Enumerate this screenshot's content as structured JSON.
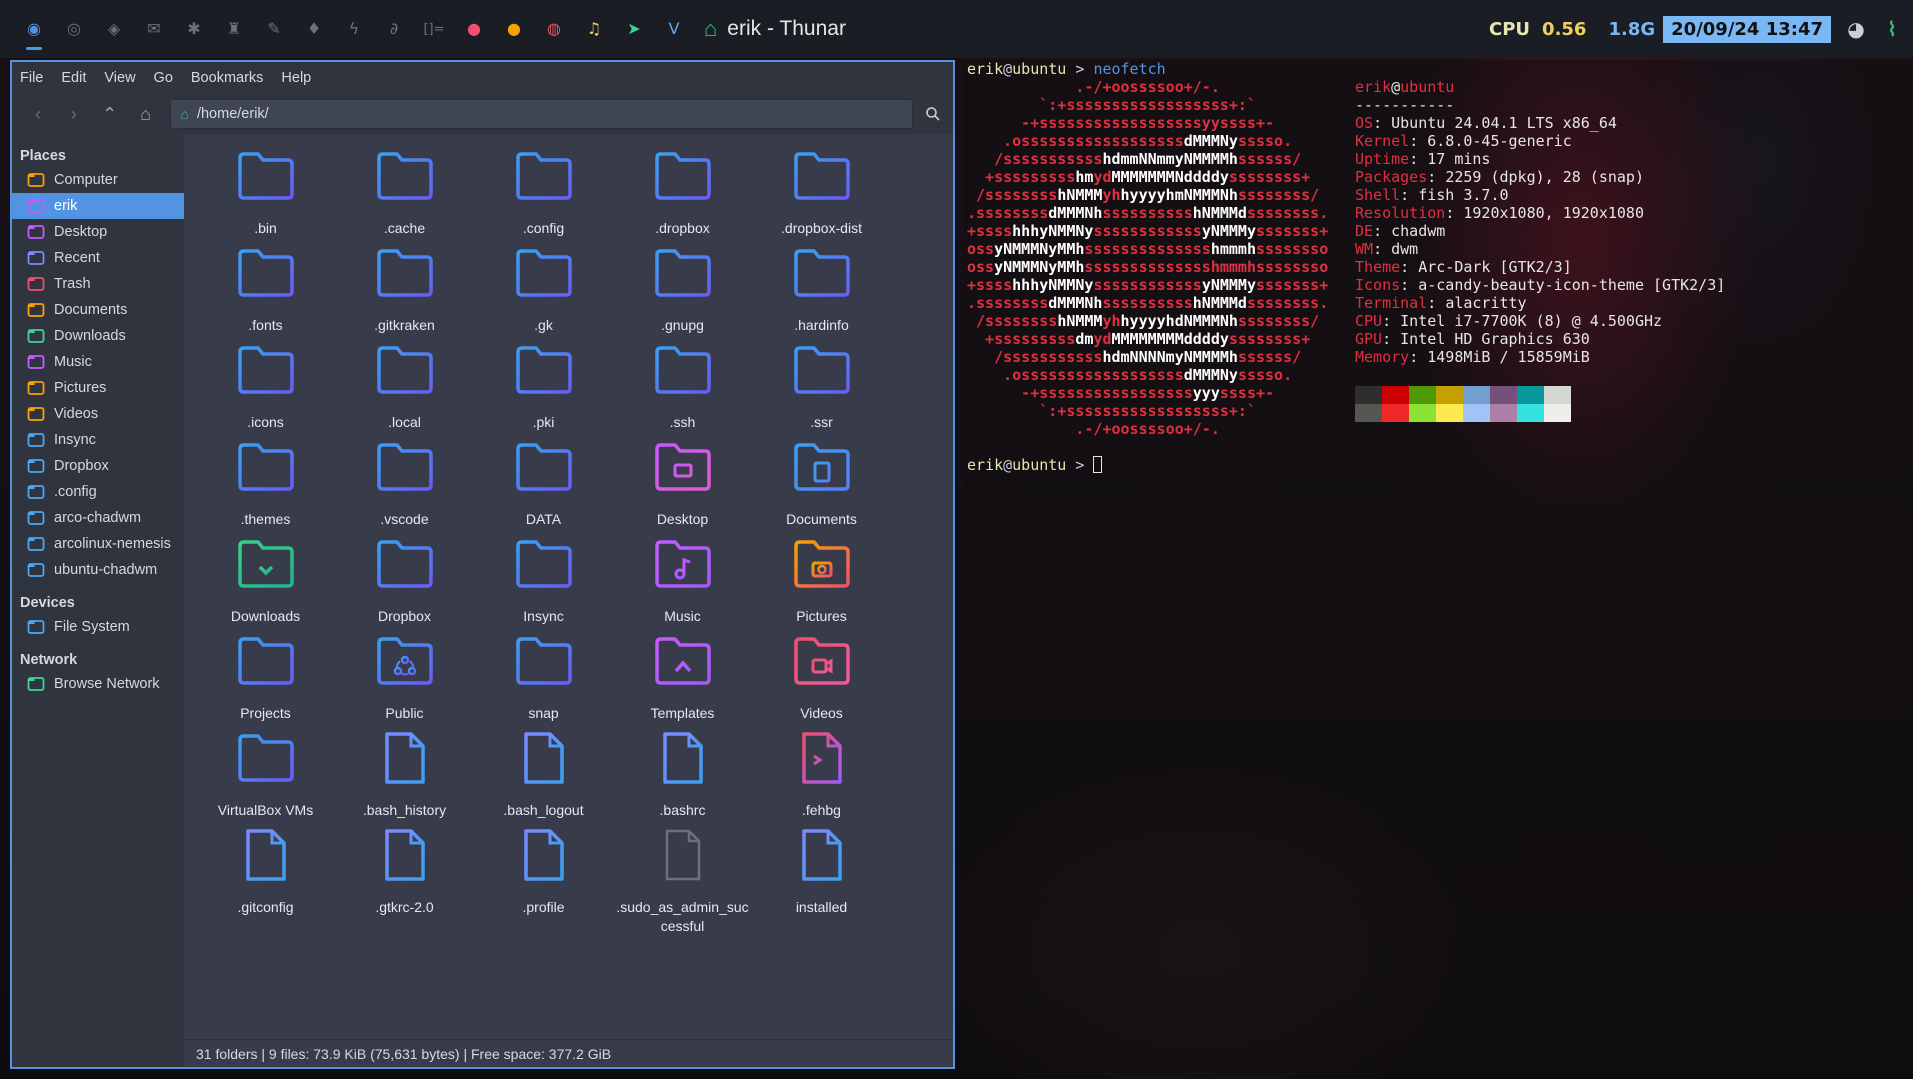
{
  "topbar": {
    "tags": [
      {
        "icon": "arch-icon",
        "glyph": "◉",
        "color": "#5294e2",
        "active": true
      },
      {
        "icon": "chrome-icon",
        "glyph": "◎",
        "color": "#6a7080"
      },
      {
        "icon": "pocket-icon",
        "glyph": "◈",
        "color": "#6a7080"
      },
      {
        "icon": "mail-icon",
        "glyph": "✉",
        "color": "#6a7080"
      },
      {
        "icon": "slack-icon",
        "glyph": "✱",
        "color": "#6a7080"
      },
      {
        "icon": "trophy-icon",
        "glyph": "♜",
        "color": "#6a7080"
      },
      {
        "icon": "wrench-icon",
        "glyph": "✎",
        "color": "#6a7080"
      },
      {
        "icon": "drop-icon",
        "glyph": "♦",
        "color": "#6a7080"
      },
      {
        "icon": "bolt-icon",
        "glyph": "ϟ",
        "color": "#6a7080"
      },
      {
        "icon": "paperclip-icon",
        "glyph": "∂",
        "color": "#6a7080"
      },
      {
        "icon": "layout-icon",
        "glyph": "[]=",
        "color": "#6a7080"
      },
      {
        "icon": "gitkraken-icon",
        "glyph": "●",
        "color": "#f0506e"
      },
      {
        "icon": "firefox-icon",
        "glyph": "●",
        "color": "#f7a200"
      },
      {
        "icon": "dribbble-icon",
        "glyph": "◍",
        "color": "#e8546a"
      },
      {
        "icon": "music-icon",
        "glyph": "♫",
        "color": "#f0d060"
      },
      {
        "icon": "telegram-icon",
        "glyph": "➤",
        "color": "#3fd494"
      },
      {
        "icon": "vivaldi-icon",
        "glyph": "V",
        "color": "#5aa8f0"
      }
    ],
    "window_title": "erik - Thunar",
    "cpu_label": "CPU",
    "cpu_value": "0.56",
    "mem_value": "1.8G",
    "datetime": "20/09/24 13:47"
  },
  "thunar": {
    "menu": [
      "File",
      "Edit",
      "View",
      "Go",
      "Bookmarks",
      "Help"
    ],
    "path": "/home/erik/",
    "sidebar": {
      "places_label": "Places",
      "places": [
        {
          "label": "Computer",
          "icon": "computer-icon",
          "color": "#f7a200"
        },
        {
          "label": "erik",
          "icon": "home-icon",
          "color": "#c45bff",
          "selected": true
        },
        {
          "label": "Desktop",
          "icon": "desktop-icon",
          "color": "#c45bff"
        },
        {
          "label": "Recent",
          "icon": "recent-icon",
          "color": "#7a8aff"
        },
        {
          "label": "Trash",
          "icon": "trash-icon",
          "color": "#f0506e"
        },
        {
          "label": "Documents",
          "icon": "documents-icon",
          "color": "#f7a200"
        },
        {
          "label": "Downloads",
          "icon": "downloads-icon",
          "color": "#3fd494"
        },
        {
          "label": "Music",
          "icon": "music-folder-icon",
          "color": "#c45bff"
        },
        {
          "label": "Pictures",
          "icon": "pictures-icon",
          "color": "#f7a200"
        },
        {
          "label": "Videos",
          "icon": "videos-icon",
          "color": "#f7a200"
        },
        {
          "label": "Insync",
          "icon": "folder-icon",
          "color": "#4aa8f5"
        },
        {
          "label": "Dropbox",
          "icon": "folder-icon",
          "color": "#4aa8f5"
        },
        {
          "label": ".config",
          "icon": "folder-icon",
          "color": "#4aa8f5"
        },
        {
          "label": "arco-chadwm",
          "icon": "folder-icon",
          "color": "#4aa8f5"
        },
        {
          "label": "arcolinux-nemesis",
          "icon": "folder-icon",
          "color": "#4aa8f5"
        },
        {
          "label": "ubuntu-chadwm",
          "icon": "folder-icon",
          "color": "#4aa8f5"
        }
      ],
      "devices_label": "Devices",
      "devices": [
        {
          "label": "File System",
          "icon": "drive-icon",
          "color": "#4aa8f5"
        }
      ],
      "network_label": "Network",
      "network": [
        {
          "label": "Browse Network",
          "icon": "network-icon",
          "color": "#3fd494"
        }
      ]
    },
    "files": [
      {
        "name": ".bin",
        "type": "folder"
      },
      {
        "name": ".cache",
        "type": "folder"
      },
      {
        "name": ".config",
        "type": "folder"
      },
      {
        "name": ".dropbox",
        "type": "folder"
      },
      {
        "name": ".dropbox-dist",
        "type": "folder"
      },
      {
        "name": ".fonts",
        "type": "folder"
      },
      {
        "name": ".gitkraken",
        "type": "folder"
      },
      {
        "name": ".gk",
        "type": "folder"
      },
      {
        "name": ".gnupg",
        "type": "folder"
      },
      {
        "name": ".hardinfo",
        "type": "folder"
      },
      {
        "name": ".icons",
        "type": "folder"
      },
      {
        "name": ".local",
        "type": "folder"
      },
      {
        "name": ".pki",
        "type": "folder"
      },
      {
        "name": ".ssh",
        "type": "folder"
      },
      {
        "name": ".ssr",
        "type": "folder"
      },
      {
        "name": ".themes",
        "type": "folder"
      },
      {
        "name": ".vscode",
        "type": "folder"
      },
      {
        "name": "DATA",
        "type": "folder"
      },
      {
        "name": "Desktop",
        "type": "folder-desktop"
      },
      {
        "name": "Documents",
        "type": "folder-documents"
      },
      {
        "name": "Downloads",
        "type": "folder-downloads"
      },
      {
        "name": "Dropbox",
        "type": "folder"
      },
      {
        "name": "Insync",
        "type": "folder"
      },
      {
        "name": "Music",
        "type": "folder-music"
      },
      {
        "name": "Pictures",
        "type": "folder-pictures"
      },
      {
        "name": "Projects",
        "type": "folder"
      },
      {
        "name": "Public",
        "type": "folder-public"
      },
      {
        "name": "snap",
        "type": "folder"
      },
      {
        "name": "Templates",
        "type": "folder-templates"
      },
      {
        "name": "Videos",
        "type": "folder-videos"
      },
      {
        "name": "VirtualBox VMs",
        "type": "folder"
      },
      {
        "name": ".bash_history",
        "type": "text"
      },
      {
        "name": ".bash_logout",
        "type": "text"
      },
      {
        "name": ".bashrc",
        "type": "text"
      },
      {
        "name": ".fehbg",
        "type": "script"
      },
      {
        "name": ".gitconfig",
        "type": "text"
      },
      {
        "name": ".gtkrc-2.0",
        "type": "text"
      },
      {
        "name": ".profile",
        "type": "text"
      },
      {
        "name": ".sudo_as_admin_successful",
        "type": "empty"
      },
      {
        "name": "installed",
        "type": "text"
      }
    ],
    "status_text": "31 folders  |  9 files: 73.9 KiB (75,631 bytes)  |  Free space: 377.2 GiB"
  },
  "terminal": {
    "user": "erik",
    "at": "@",
    "host": "ubuntu",
    "arrow": " > ",
    "command": "neofetch",
    "art": [
      "            .-/+oossssoo+/-.",
      "        `:+ssssssssssssssssss+:`",
      "      -+ssssssssssssssssssyyssss+-",
      "    .ossssssssssssssssss|dMMMNy|sssso.",
      "   /sssssssssss|hdmmNNmmyNMMMMh|ssssss/",
      "  +sssssssss|hm|yd|MMMMMMMNddddy|ssssssss+",
      " /ssssssss|hNMMM|yh|hyyyyhmNMMMNh|ssssssss/",
      ".ssssssss|dMMMNh|ssssssssss|hNMMMd|ssssssss.",
      "+ssss|hhhyNMMNy|ssssssssssss|yNMMMy|sssssss+",
      "oss|yNMMMNyMMh|ssssssssssssss|hmmmh|ssssssso",
      "oss|yNMMMNyMMh|sssssssssssssshmmmhssssssso",
      "+ssss|hhhyNMMNy|ssssssssssss|yNMMMy|sssssss+",
      ".ssssssss|dMMMNh|ssssssssss|hNMMMd|ssssssss.",
      " /ssssssss|hNMMM|yh|hyyyyhdNMMMNh|ssssssss/",
      "  +sssssssss|dm|yd|MMMMMMMMddddy|ssssssss+",
      "   /sssssssssss|hdmNNNNmyNMMMMh|ssssss/",
      "    .ossssssssssssssssss|dMMMNy|sssso.",
      "      -+sssssssssssssssss|yyy|ssss+-",
      "        `:+ssssssssssssssssss+:`",
      "            .-/+oossssoo+/-."
    ],
    "info_title_user": "erik",
    "info_title_host": "ubuntu",
    "info_sep": "-----------",
    "info": [
      {
        "k": "OS",
        "v": "Ubuntu 24.04.1 LTS x86_64"
      },
      {
        "k": "Kernel",
        "v": "6.8.0-45-generic"
      },
      {
        "k": "Uptime",
        "v": "17 mins"
      },
      {
        "k": "Packages",
        "v": "2259 (dpkg), 28 (snap)"
      },
      {
        "k": "Shell",
        "v": "fish 3.7.0"
      },
      {
        "k": "Resolution",
        "v": "1920x1080, 1920x1080"
      },
      {
        "k": "DE",
        "v": "chadwm"
      },
      {
        "k": "WM",
        "v": "dwm"
      },
      {
        "k": "Theme",
        "v": "Arc-Dark [GTK2/3]"
      },
      {
        "k": "Icons",
        "v": "a-candy-beauty-icon-theme [GTK2/3]"
      },
      {
        "k": "Terminal",
        "v": "alacritty"
      },
      {
        "k": "CPU",
        "v": "Intel i7-7700K (8) @ 4.500GHz"
      },
      {
        "k": "GPU",
        "v": "Intel HD Graphics 630"
      },
      {
        "k": "Memory",
        "v": "1498MiB / 15859MiB"
      }
    ],
    "swatches_top": [
      "#2e2e2e",
      "#cc0000",
      "#4e9a06",
      "#c4a000",
      "#729fcf",
      "#75507b",
      "#06989a",
      "#d3d7cf"
    ],
    "swatches_bottom": [
      "#555753",
      "#ef2929",
      "#8ae234",
      "#fce94f",
      "#9fc4f5",
      "#ad7fa8",
      "#34e2e2",
      "#eeeeec"
    ]
  }
}
